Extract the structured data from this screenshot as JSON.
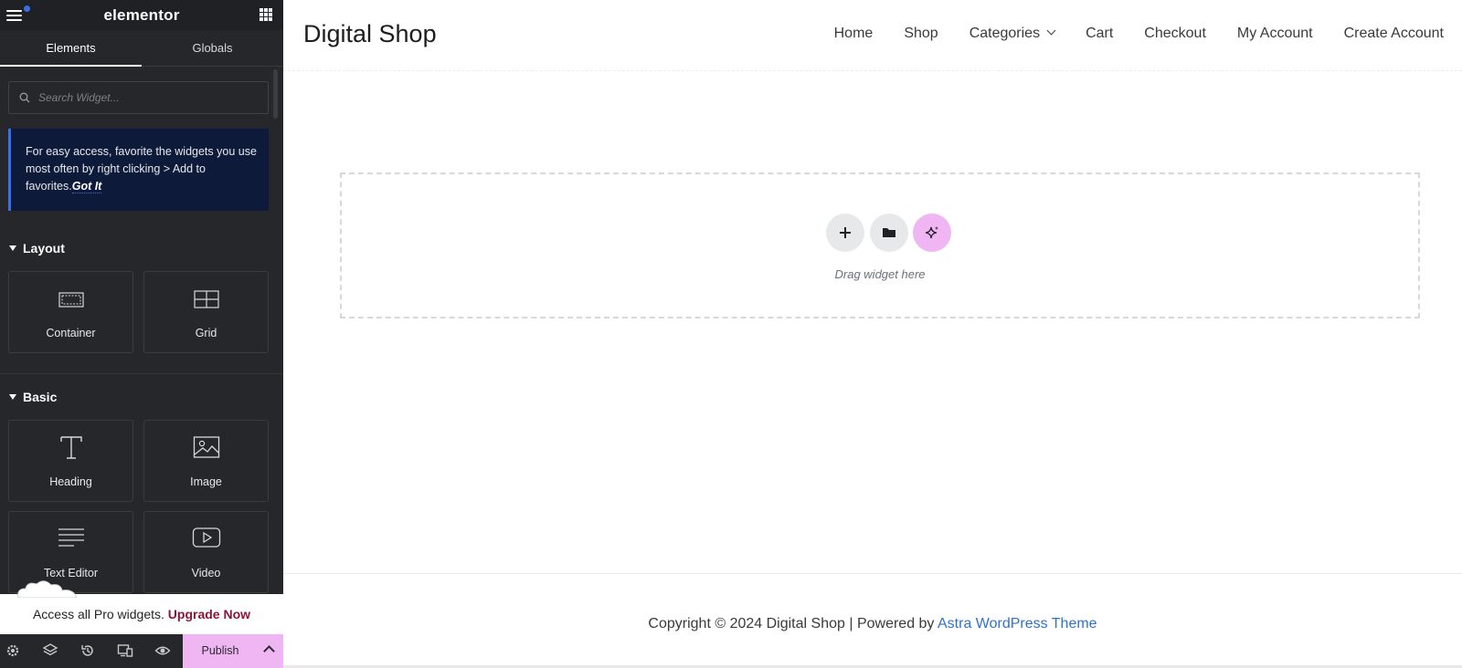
{
  "editor": {
    "logo": "elementor",
    "tabs": [
      "Elements",
      "Globals"
    ],
    "search_placeholder": "Search Widget...",
    "tip": {
      "text": "For easy access, favorite the widgets you use most often by right clicking > Add to favorites.",
      "action": "Got It"
    },
    "sections": {
      "layout": {
        "title": "Layout",
        "widgets": [
          {
            "label": "Container",
            "icon": "container-icon"
          },
          {
            "label": "Grid",
            "icon": "grid-icon"
          }
        ]
      },
      "basic": {
        "title": "Basic",
        "widgets": [
          {
            "label": "Heading",
            "icon": "heading-icon"
          },
          {
            "label": "Image",
            "icon": "image-icon"
          },
          {
            "label": "Text Editor",
            "icon": "text-editor-icon"
          },
          {
            "label": "Video",
            "icon": "video-icon"
          }
        ]
      }
    },
    "pro_bar": {
      "text": "Access all Pro widgets.",
      "link": "Upgrade Now"
    },
    "bottom_bar": {
      "icons": [
        "settings-icon",
        "layers-icon",
        "history-icon",
        "responsive-icon",
        "preview-icon"
      ],
      "publish_label": "Publish"
    }
  },
  "site": {
    "title": "Digital Shop",
    "nav": [
      "Home",
      "Shop",
      "Categories",
      "Cart",
      "Checkout",
      "My Account",
      "Create Account"
    ],
    "dropzone_label": "Drag widget here",
    "footer": {
      "prefix": "Copyright © 2024 Digital Shop | Powered by ",
      "link": "Astra WordPress Theme"
    }
  },
  "colors": {
    "panel_bg": "#26272b",
    "accent_pink": "#f0b6f4",
    "tip_bg": "#0d1a3a",
    "tip_border": "#3b6fe6",
    "upgrade": "#8b1538",
    "link_blue": "#2f73c8"
  }
}
